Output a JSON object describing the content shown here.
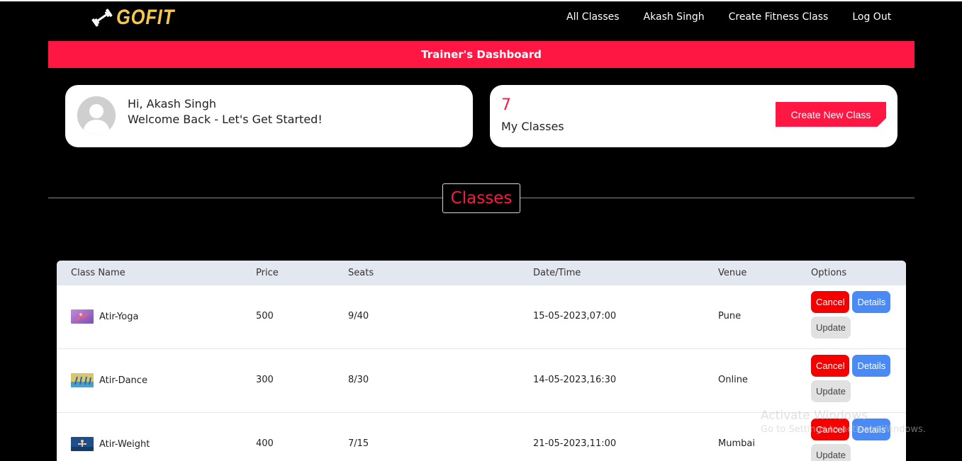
{
  "brand": {
    "name": "GOFIT",
    "logo_icon": "dumbbell-icon",
    "color": "#f5c84c"
  },
  "nav": {
    "links": [
      "All Classes",
      "Akash Singh",
      "Create Fitness Class",
      "Log Out"
    ]
  },
  "banner": {
    "title": "Trainer's Dashboard",
    "color": "#ff1744"
  },
  "welcome": {
    "greeting": "Hi, Akash Singh",
    "message": "Welcome Back - Let's Get Started!",
    "avatar_icon": "user-avatar-icon"
  },
  "stats": {
    "count": "7",
    "label": "My Classes",
    "create_button": "Create New Class"
  },
  "section": {
    "title": "Classes"
  },
  "table": {
    "headers": [
      "Class Name",
      "Price",
      "Seats",
      "Date/Time",
      "Venue",
      "Options"
    ],
    "rows": [
      {
        "name": "Atir-Yoga",
        "price": "500",
        "seats": "9/40",
        "datetime": "15-05-2023,07:00",
        "venue": "Pune"
      },
      {
        "name": "Atir-Dance",
        "price": "300",
        "seats": "8/30",
        "datetime": "14-05-2023,16:30",
        "venue": "Online"
      },
      {
        "name": "Atir-Weight",
        "price": "400",
        "seats": "7/15",
        "datetime": "21-05-2023,11:00",
        "venue": "Mumbai"
      }
    ],
    "buttons": {
      "cancel": "Cancel",
      "details": "Details",
      "update": "Update"
    }
  },
  "watermark": {
    "title": "Activate Windows",
    "subtitle": "Go to Settings to activate Windows."
  },
  "colors": {
    "accent": "#ff1744",
    "cancel": "#f50000",
    "details": "#4a8af4",
    "update": "#e1e1e1"
  }
}
